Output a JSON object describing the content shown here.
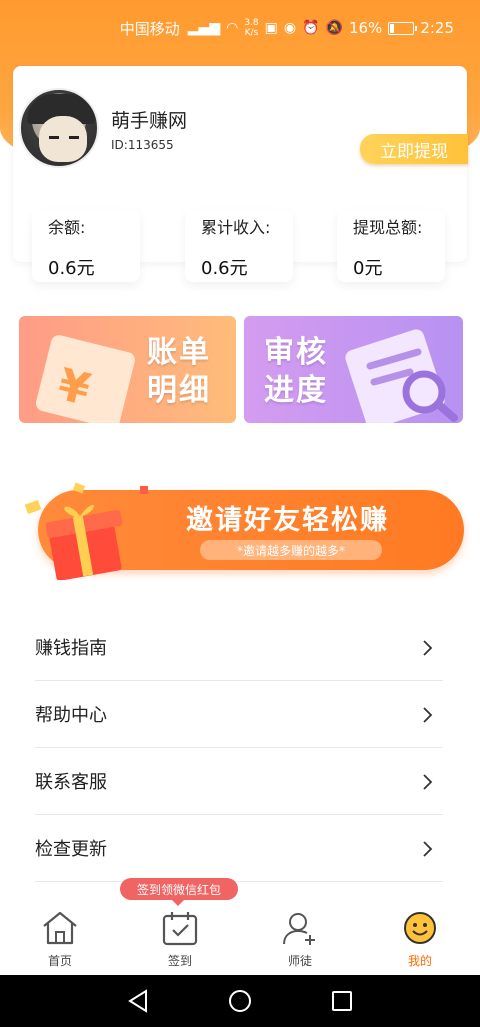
{
  "status_bar": {
    "carrier": "中国移动",
    "net_speed_value": "3.8",
    "net_speed_unit": "K/s",
    "battery": "16%",
    "time": "2:25"
  },
  "profile": {
    "name": "萌手赚网",
    "id": "ID:113655",
    "withdraw_button": "立即提现"
  },
  "stats": [
    {
      "label": "余额:",
      "value": "0.6元"
    },
    {
      "label": "累计收入:",
      "value": "0.6元"
    },
    {
      "label": "提现总额:",
      "value": "0元"
    }
  ],
  "tiles": {
    "bill": {
      "line1": "账单",
      "line2": "明细"
    },
    "review": {
      "line1": "审核",
      "line2": "进度"
    }
  },
  "invite": {
    "title": "邀请好友轻松赚",
    "subtitle": "*邀请越多赚的越多*"
  },
  "menu": [
    {
      "label": "赚钱指南"
    },
    {
      "label": "帮助中心"
    },
    {
      "label": "联系客服"
    },
    {
      "label": "检查更新"
    }
  ],
  "tabbar": {
    "tooltip": "签到领微信红包",
    "tabs": [
      {
        "label": "首页",
        "icon": "home-icon"
      },
      {
        "label": "签到",
        "icon": "calendar-check-icon"
      },
      {
        "label": "师徒",
        "icon": "user-add-icon"
      },
      {
        "label": "我的",
        "icon": "smiley-icon"
      }
    ],
    "active_color": "#ff6a00"
  },
  "colors": {
    "header_orange": "#ff9a2e",
    "withdraw_yellow": "#ffc23a",
    "invite_orange": "#ff7a22"
  }
}
